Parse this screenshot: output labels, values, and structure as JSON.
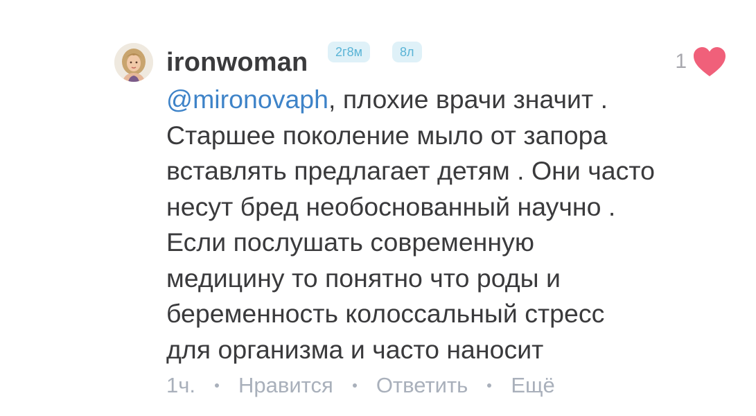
{
  "comment": {
    "author": "ironwoman",
    "badges": {
      "age": "2г8м",
      "count": "8л"
    },
    "likes": "1",
    "mention": "@mironovaph",
    "lines": [
      ", плохие врачи значит .",
      "Старшее поколение мыло от запора",
      "вставлять предлагает детям . Они часто",
      "несут бред необоснованный научно .",
      "Если послушать современную",
      "медицину то понятно что роды  и",
      "беременность колоссальный стресс",
      "для организма и часто наносит"
    ],
    "time": "1ч.",
    "actions": {
      "like": "Нравится",
      "reply": "Ответить",
      "more": "Ещё"
    }
  },
  "icons": {
    "avatar": "avatar-girl",
    "like": "heart-icon"
  },
  "colors": {
    "heart": "#f0607a",
    "mention": "#3e83c8",
    "badge_bg": "#dff1f8",
    "badge_text": "#5ab4d6",
    "meta": "#a9b0bb",
    "text": "#3a3a3c"
  }
}
